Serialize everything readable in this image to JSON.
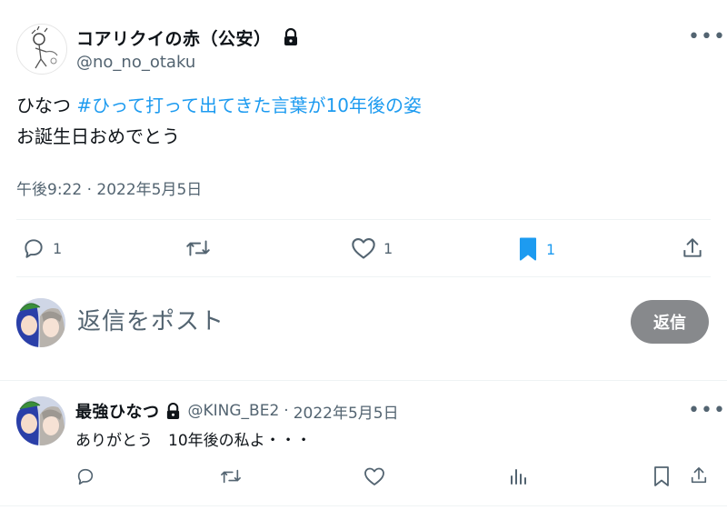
{
  "main_tweet": {
    "author_name": "コアリクイの赤（公安）",
    "author_handle": "@no_no_otaku",
    "text_prefix": "ひなつ ",
    "hashtag": "#ひって打って出てきた言葉が10年後の姿",
    "text_line2": "お誕生日おめでとう",
    "timestamp": "午後9:22 · 2022年5月5日",
    "more_icon": "more-dots-icon",
    "lock_icon": "lock-icon",
    "stats": {
      "replies": "1",
      "retweets": "",
      "likes": "1",
      "bookmarks": "1"
    }
  },
  "compose": {
    "placeholder": "返信をポスト",
    "button_label": "返信"
  },
  "reply": {
    "author_name": "最強ひなつ",
    "author_handle": "@KING_BE2",
    "separator": "·",
    "date": "2022年5月5日",
    "text": "ありがとう　10年後の私よ・・・"
  },
  "colors": {
    "accent": "#1d9bf0",
    "muted": "#536471",
    "button_disabled": "#87898c"
  }
}
